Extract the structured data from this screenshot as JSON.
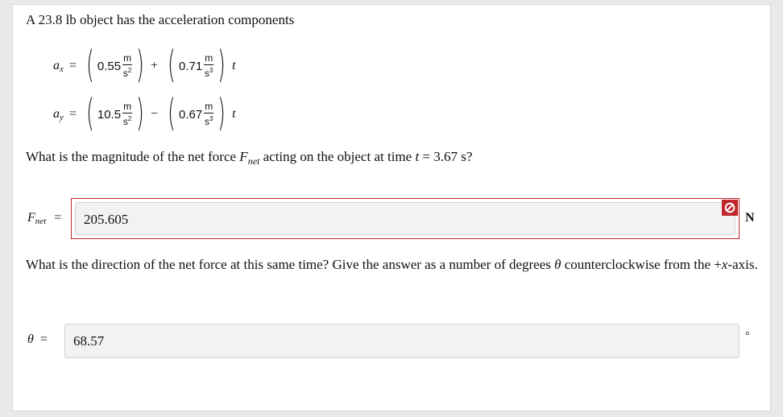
{
  "problem": {
    "intro": "A 23.8 lb object has the acceleration components",
    "ax": {
      "var": "a",
      "sub": "x",
      "c1": "0.55",
      "u1_num": "m",
      "u1_den": "s",
      "u1_pow": "2",
      "op": "+",
      "c2": "0.71",
      "u2_num": "m",
      "u2_den": "s",
      "u2_pow": "3",
      "t": "t"
    },
    "ay": {
      "var": "a",
      "sub": "y",
      "c1": "10.5",
      "u1_num": "m",
      "u1_den": "s",
      "u1_pow": "2",
      "op": "−",
      "c2": "0.67",
      "u2_num": "m",
      "u2_den": "s",
      "u2_pow": "3",
      "t": "t"
    },
    "q1": {
      "pre": "What is the magnitude of the net force ",
      "F": "F",
      "F_sub": "net",
      "mid": " acting on the object at time ",
      "t": "t",
      "post": " = 3.67 s?"
    },
    "q2": {
      "pre": "What is the direction of the net force at this same time? Give the answer as a number of degrees ",
      "theta": "θ",
      "mid": " counterclockwise from the +",
      "x": "x",
      "post": "-axis."
    }
  },
  "answers": {
    "force": {
      "label_var": "F",
      "label_sub": "net",
      "equals": "=",
      "value": "205.605",
      "status": "incorrect",
      "unit": "N"
    },
    "direction": {
      "label_var": "θ",
      "equals": "=",
      "value": "68.57",
      "unit": "°"
    }
  },
  "colors": {
    "error": "#c0272d",
    "field_bg": "#f2f2f2",
    "page_bg": "#e9e9e9"
  },
  "icons": {
    "error_badge": "no-entry-icon"
  }
}
